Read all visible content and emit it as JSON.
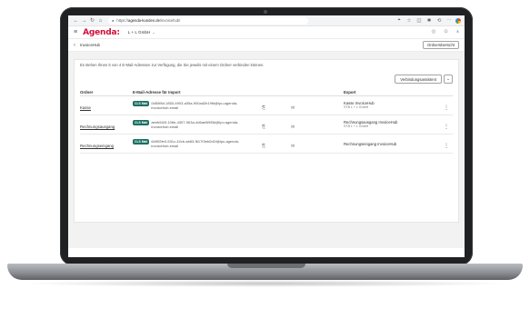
{
  "browser": {
    "url_prefix": "https://",
    "url_domain": "agenda-kunden.de",
    "url_path": "/invoicehub/",
    "icons": [
      "arrow-left-icon",
      "arrow-right-icon",
      "reload-icon",
      "home-icon",
      "lock-icon",
      "translate-icon",
      "star-icon",
      "sidebar-icon",
      "extensions-icon",
      "history-icon",
      "more-icon",
      "profile-icon"
    ]
  },
  "app": {
    "logo": "Agenda:",
    "company": "L + L GmbH",
    "brand_color": "#d0103a"
  },
  "page": {
    "breadcrumb": "InvoiceHub",
    "ordner_button": "Ordnerübersicht",
    "intro": "Es stehen Ihnen 5 von 4 E-Mail-Adressen zur Verfügung, die Sie jeweils mit einem Ordner verbinden können.",
    "assistant_button": "Verbindungsassistent"
  },
  "table": {
    "headers": [
      "Ordner",
      "E-Mail-Adresse für Import",
      "Export"
    ],
    "badge_color": "#1b6f61",
    "rows": [
      {
        "folder": "Kasse",
        "badge": "CLS Mail",
        "email": "0d50f8d-1853-4903-a35a-900ad2b19fd@ipu.agenda-invoicehub.email",
        "export_main": "Kasse InvoiceHub",
        "export_sub": "STB L + L GmbH"
      },
      {
        "folder": "Rechnungsausgang",
        "badge": "CLS Mail",
        "email": "aeeb540f-10bb-4307-963a-4d6ae5f6f3d@ipu.agenda-invoicehub.email",
        "export_main": "Rechnungsausgang InvoiceHub",
        "export_sub": "STB L + L GmbH"
      },
      {
        "folder": "Rechnungseingang",
        "badge": "CLS Mail",
        "email": "64f0f2fe0-531c-42cb-ab83-f617f3eb0d1f@ipu.agenda-invoicehub.email",
        "export_main": "Rechnungseingang InvoiceHub",
        "export_sub": ""
      }
    ]
  }
}
